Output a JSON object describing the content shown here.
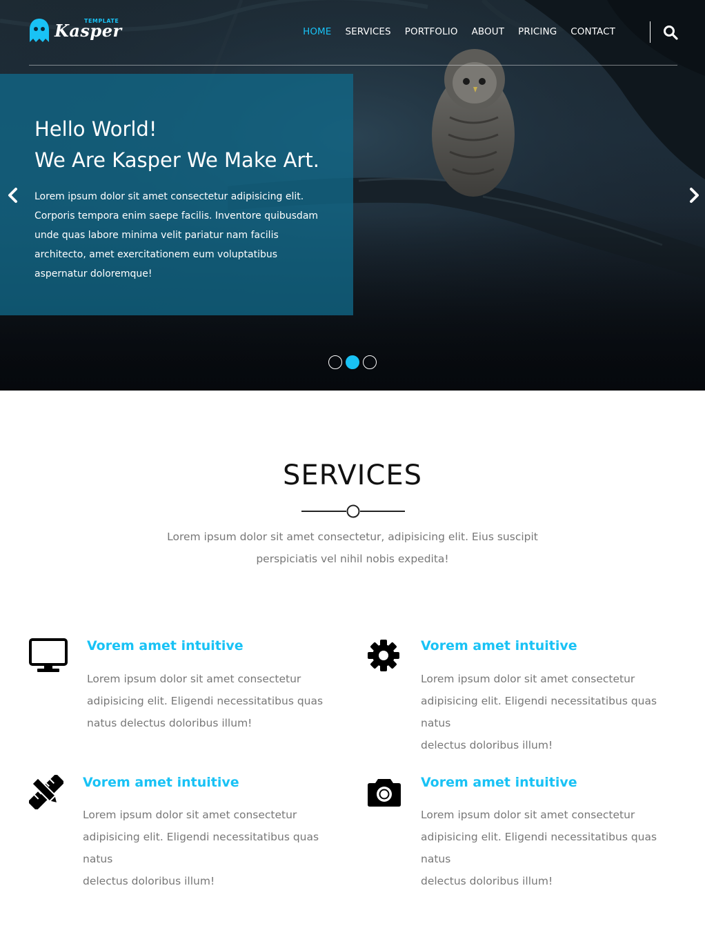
{
  "brand": {
    "name": "Kasper",
    "tag": "TEMPLATE",
    "accent": "#19c2f5"
  },
  "nav": {
    "items": [
      {
        "label": "HOME",
        "active": true
      },
      {
        "label": "SERVICES",
        "active": false
      },
      {
        "label": "PORTFOLIO",
        "active": false
      },
      {
        "label": "ABOUT",
        "active": false
      },
      {
        "label": "PRICING",
        "active": false
      },
      {
        "label": "CONTACT",
        "active": false
      }
    ],
    "search_icon": "search-icon"
  },
  "hero": {
    "title_line1": "Hello World!",
    "title_line2": "We Are Kasper We Make Art.",
    "text": "Lorem ipsum dolor sit amet consectetur adipisicing elit. Corporis tempora enim saepe facilis. Inventore quibusdam unde quas labore minima velit pariatur nam facilis architecto, amet exercitationem eum voluptatibus aspernatur doloremque!",
    "slides_total": 3,
    "active_slide": 2,
    "prev_icon": "chevron-left-icon",
    "next_icon": "chevron-right-icon"
  },
  "services": {
    "title": "SERVICES",
    "intro_line1": "Lorem ipsum dolor sit amet consectetur, adipisicing elit. Eius suscipit",
    "intro_line2": "perspiciatis vel nihil nobis expedita!",
    "items": [
      {
        "icon": "desktop-icon",
        "title": "Vorem amet intuitive",
        "line1": "Lorem ipsum dolor sit amet consectetur",
        "line2": "adipisicing elit. Eligendi necessitatibus quas",
        "line3": "natus delectus doloribus illum!"
      },
      {
        "icon": "gear-icon",
        "title": "Vorem amet intuitive",
        "line1": "Lorem ipsum dolor sit amet consectetur",
        "line2": "adipisicing elit. Eligendi necessitatibus quas natus",
        "line3": "delectus doloribus illum!"
      },
      {
        "icon": "pencil-ruler-icon",
        "title": "Vorem amet intuitive",
        "line1": "Lorem ipsum dolor sit amet consectetur",
        "line2": "adipisicing elit. Eligendi necessitatibus quas natus",
        "line3": "delectus doloribus illum!"
      },
      {
        "icon": "camera-icon",
        "title": "Vorem amet intuitive",
        "line1": "Lorem ipsum dolor sit amet consectetur",
        "line2": "adipisicing elit. Eligendi necessitatibus quas natus",
        "line3": "delectus doloribus illum!"
      }
    ]
  }
}
